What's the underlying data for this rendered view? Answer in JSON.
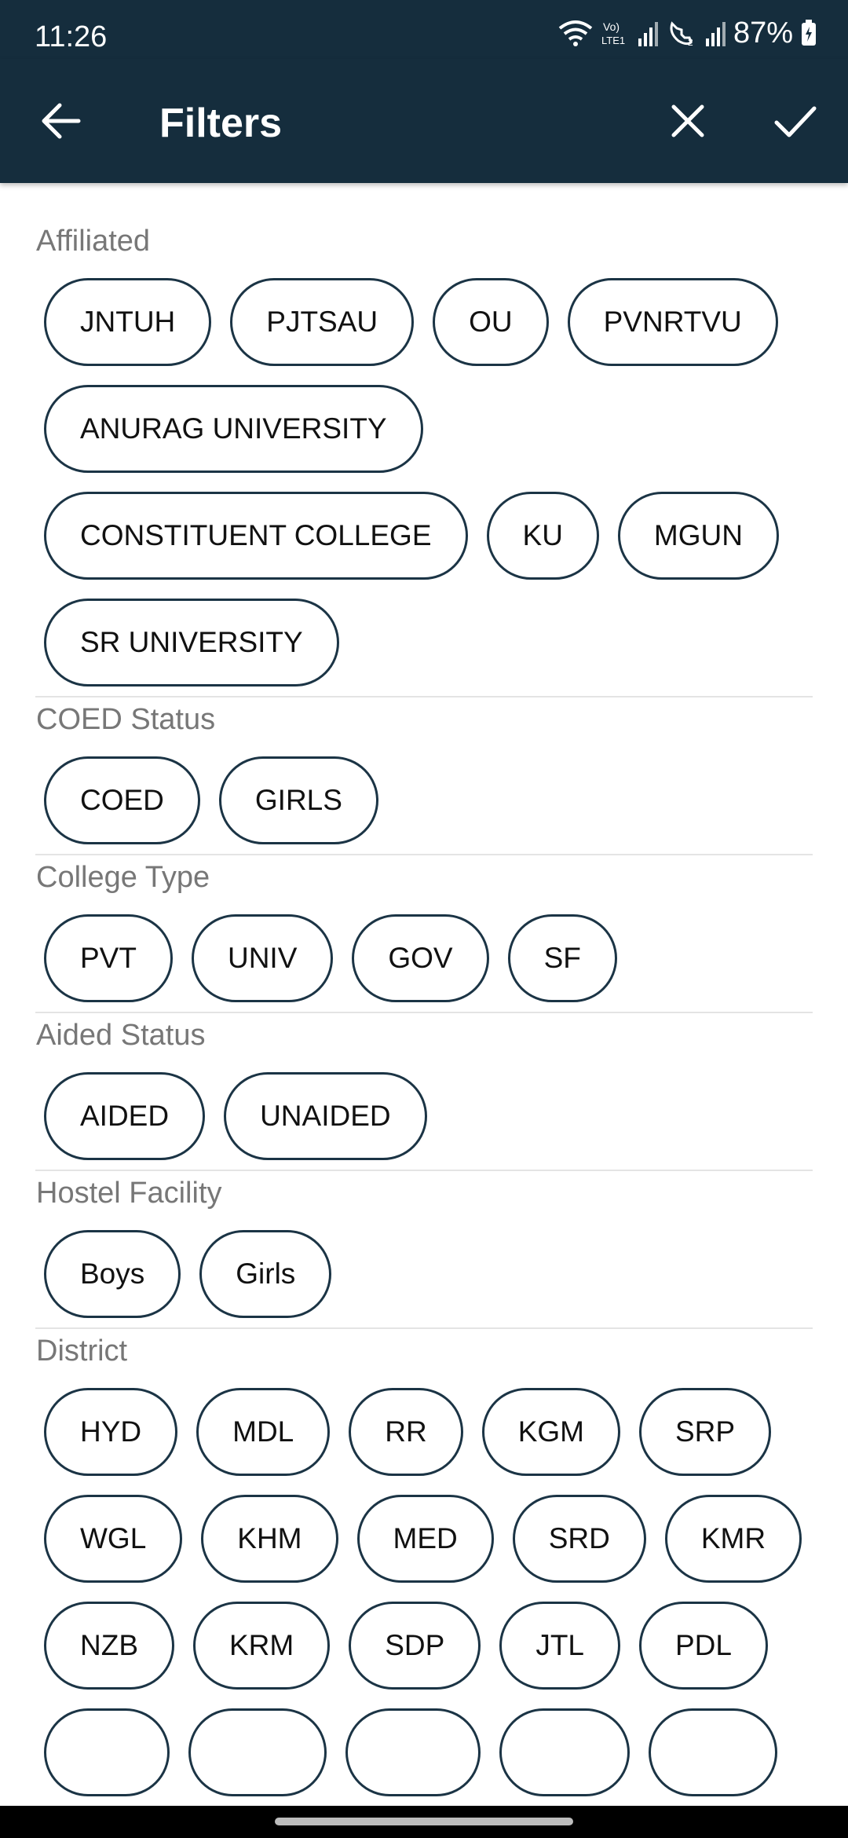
{
  "status_bar": {
    "time": "11:26",
    "battery": "87%",
    "icons": [
      "wifi-icon",
      "volte-icon",
      "signal-icon",
      "wifi-calling-icon",
      "signal-icon",
      "battery-icon"
    ],
    "color": "#152d3d"
  },
  "toolbar": {
    "title": "Filters",
    "back_icon": "arrow-back-icon",
    "close_icon": "close-icon",
    "confirm_icon": "check-icon",
    "color": "#152d3d"
  },
  "sections": [
    {
      "heading": "Affiliated",
      "chips": [
        "JNTUH",
        "PJTSAU",
        "OU",
        "PVNRTVU",
        "ANURAG UNIVERSITY",
        "CONSTITUENT COLLEGE",
        "KU",
        "MGUN",
        "SR UNIVERSITY"
      ]
    },
    {
      "heading": "COED Status",
      "chips": [
        "COED",
        "GIRLS"
      ]
    },
    {
      "heading": "College Type",
      "chips": [
        "PVT",
        "UNIV",
        "GOV",
        "SF"
      ]
    },
    {
      "heading": "Aided Status",
      "chips": [
        "AIDED",
        "UNAIDED"
      ]
    },
    {
      "heading": "Hostel Facility",
      "chips": [
        "Boys",
        "Girls"
      ]
    },
    {
      "heading": "District",
      "chips": [
        "HYD",
        "MDL",
        "RR",
        "KGM",
        "SRP",
        "WGL",
        "KHM",
        "MED",
        "SRD",
        "KMR",
        "NZB",
        "KRM",
        "SDP",
        "JTL",
        "PDL"
      ]
    }
  ],
  "chip_border_color": "#1b3445"
}
